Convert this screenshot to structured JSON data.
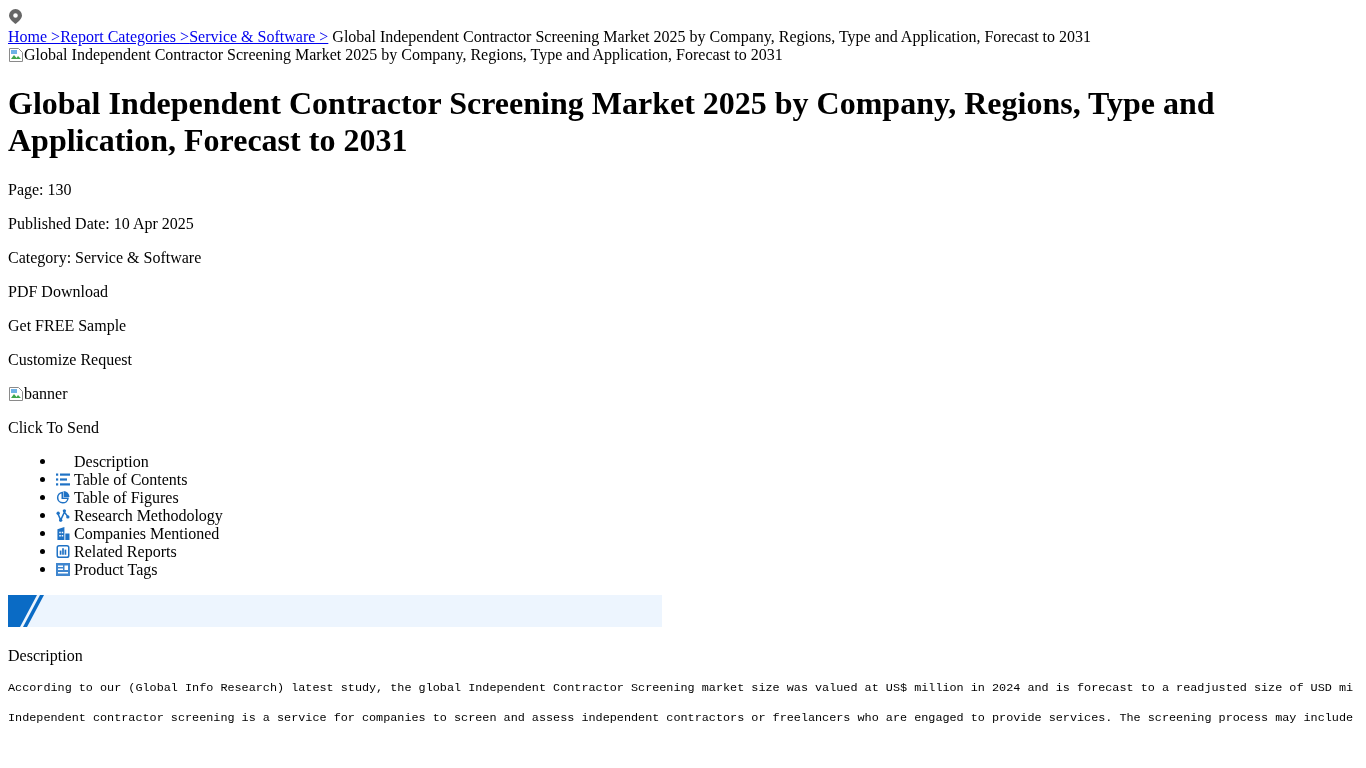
{
  "breadcrumb": {
    "links": [
      "Home >",
      "Report Categories >",
      "Service & Software >"
    ],
    "current": "Global Independent Contractor Screening Market 2025 by Company, Regions, Type and Application, Forecast to 2031"
  },
  "report_image": {
    "alt_text": "Global Independent Contractor Screening Market 2025 by Company, Regions, Type and Application, Forecast to 2031"
  },
  "title": "Global Independent Contractor Screening Market 2025 by Company, Regions, Type and Application, Forecast to 2031",
  "details": {
    "pages": "Page: 130",
    "published_date": "Published Date: 10 Apr 2025",
    "category": "Category: Service & Software"
  },
  "actions": {
    "pdf_download": "PDF Download",
    "free_sample": "Get FREE Sample",
    "customize_request": "Customize Request"
  },
  "banner_image": {
    "alt_text": "banner"
  },
  "send_button": "Click To Send",
  "tabs": [
    {
      "label": "Description",
      "kind": "blank"
    },
    {
      "label": "Table of Contents",
      "kind": "list"
    },
    {
      "label": "Table of Figures",
      "kind": "pie"
    },
    {
      "label": "Research Methodology",
      "kind": "graph"
    },
    {
      "label": "Companies Mentioned",
      "kind": "building"
    },
    {
      "label": "Related Reports",
      "kind": "chart"
    },
    {
      "label": "Product Tags",
      "kind": "panel"
    }
  ],
  "section_heading": "Description",
  "paragraphs": [
    "According to our (Global Info Research) latest study, the global Independent Contractor Screening market size was valued at US$ million in 2024 and is forecast to a readjusted size of USD mi",
    "Independent contractor screening is a service for companies to screen and assess independent contractors or freelancers who are engaged to provide services. The screening process may include"
  ]
}
